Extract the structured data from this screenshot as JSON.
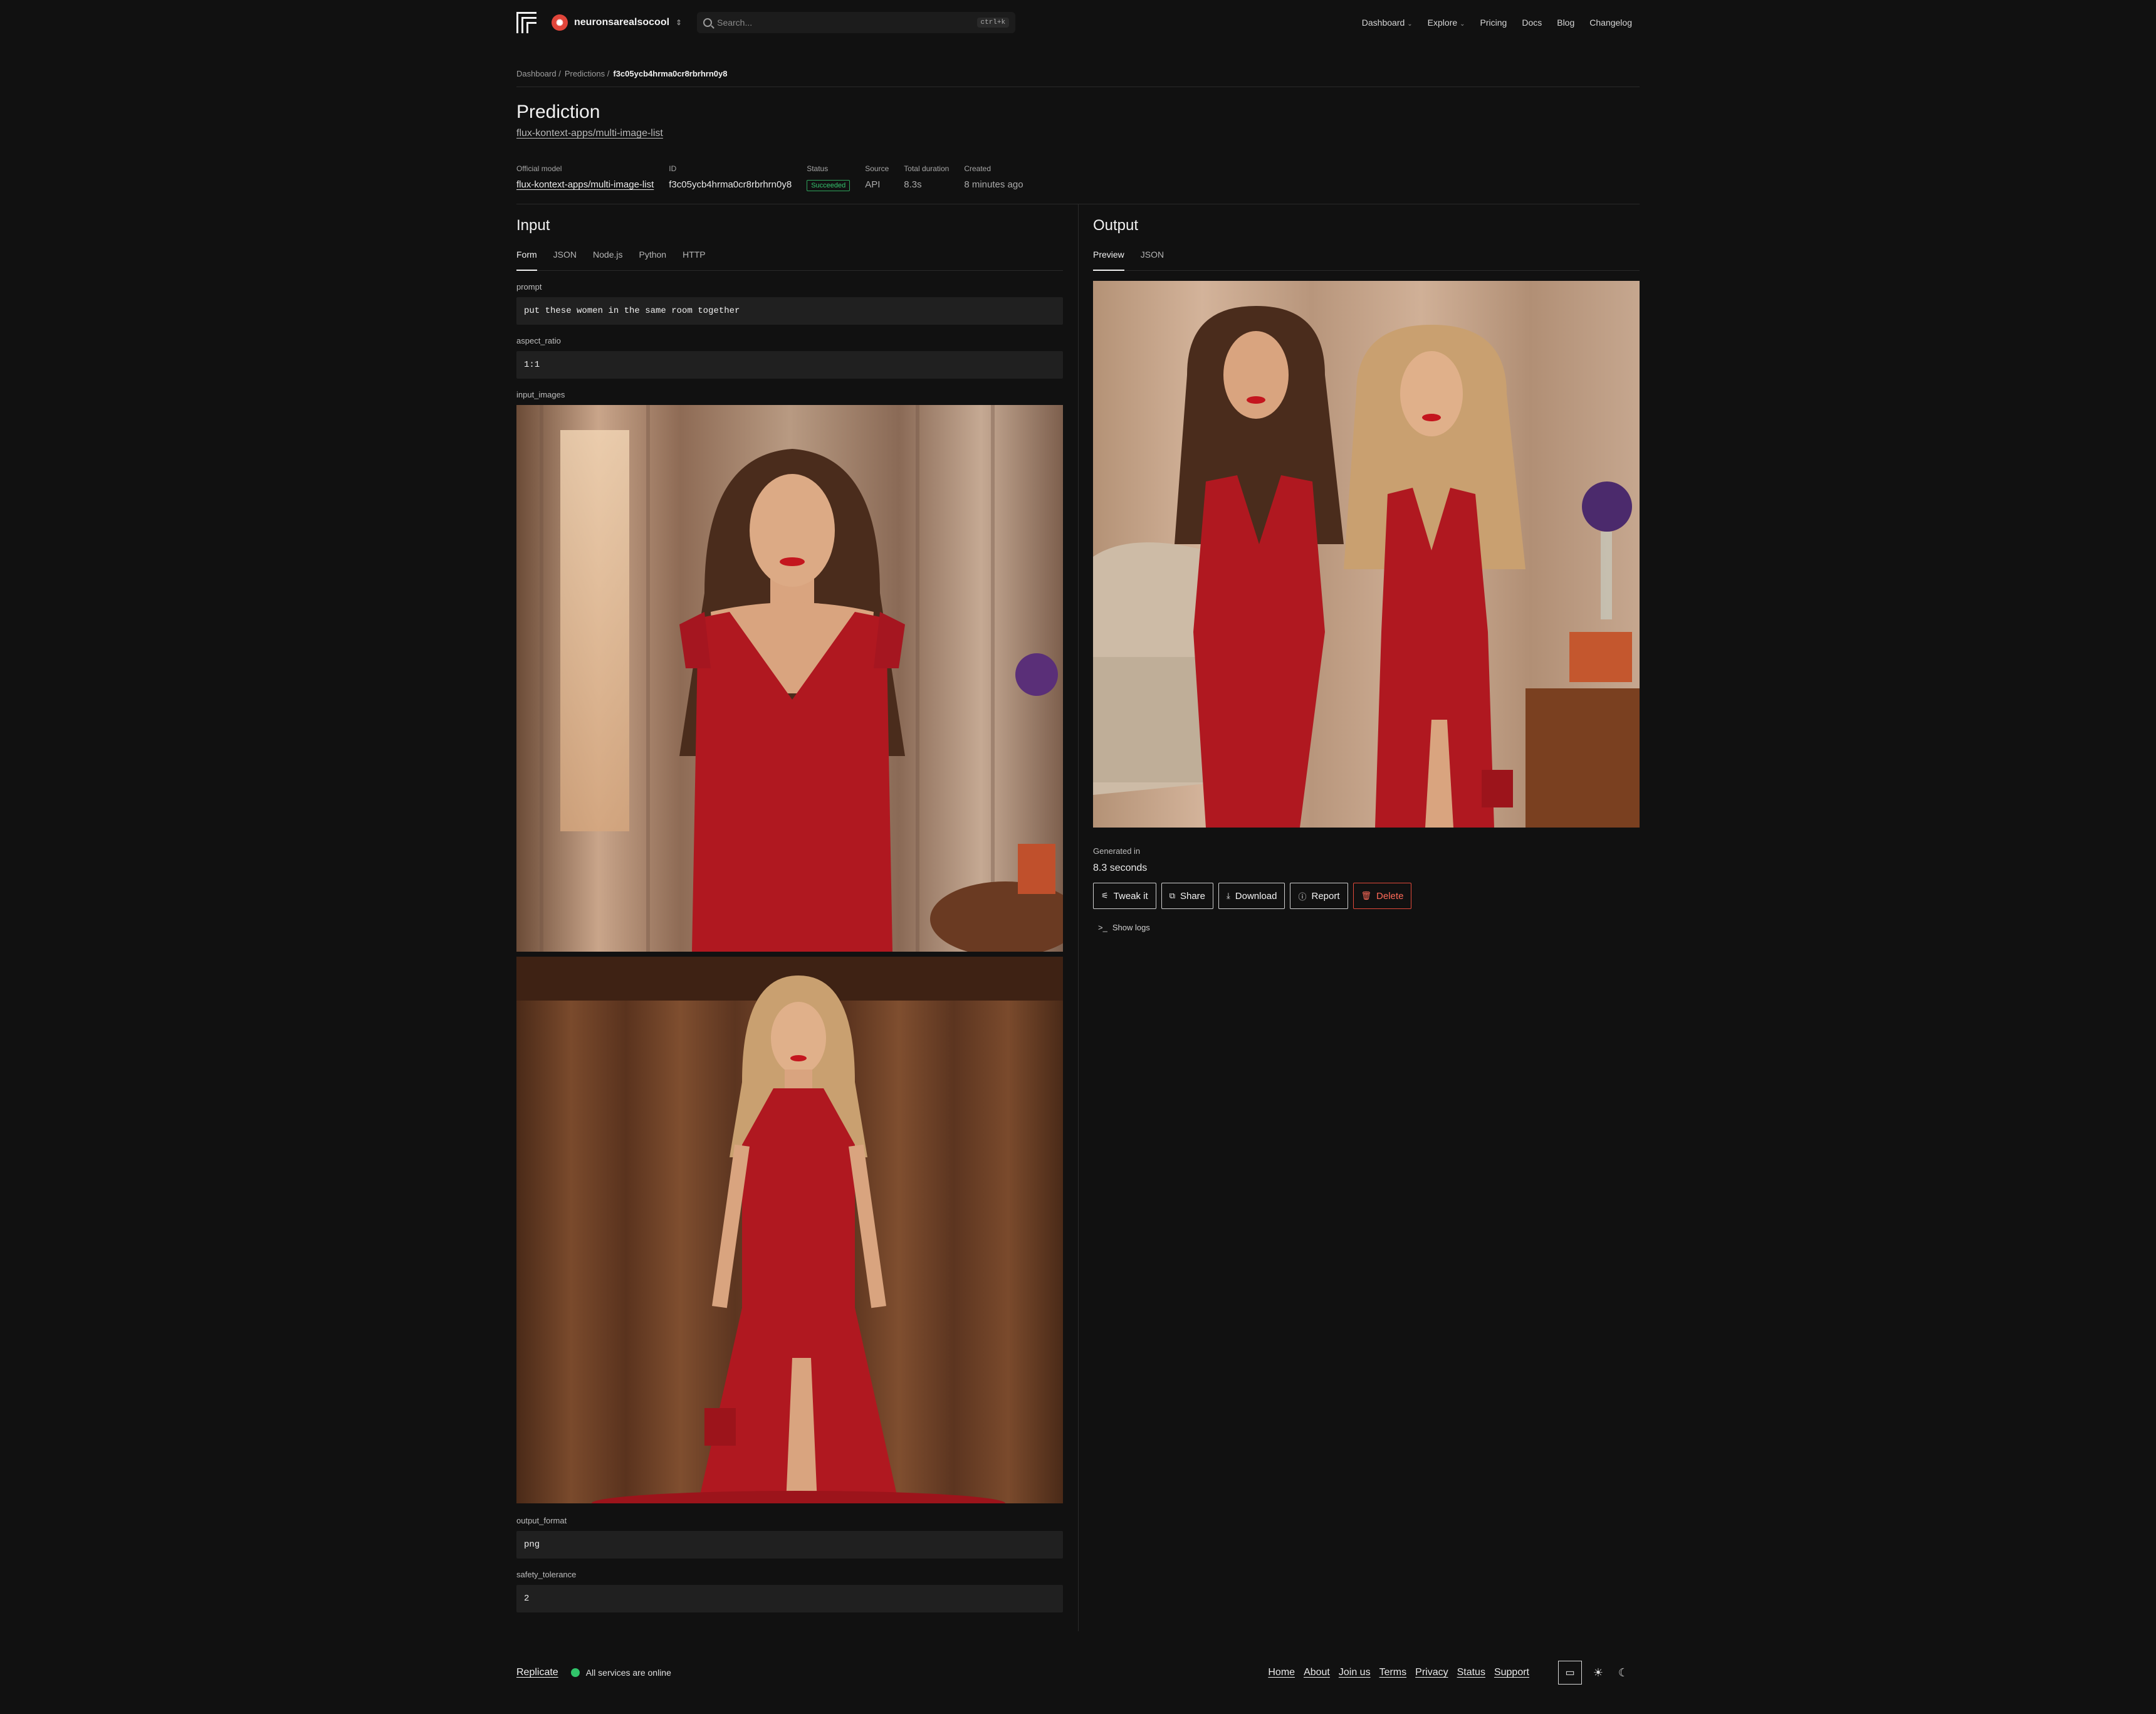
{
  "header": {
    "org_name": "neuronsarealsocool",
    "search_placeholder": "Search...",
    "search_shortcut": "ctrl+k",
    "nav": [
      "Dashboard",
      "Explore",
      "Pricing",
      "Docs",
      "Blog",
      "Changelog"
    ]
  },
  "breadcrumb": {
    "items": [
      "Dashboard /",
      "Predictions /"
    ],
    "current": "f3c05ycb4hrma0cr8rbrhrn0y8"
  },
  "page": {
    "title": "Prediction",
    "model_link": "flux-kontext-apps/multi-image-list"
  },
  "meta": {
    "official_model_label": "Official model",
    "official_model": "flux-kontext-apps/multi-image-list",
    "id_label": "ID",
    "id": "f3c05ycb4hrma0cr8rbrhrn0y8",
    "status_label": "Status",
    "status": "Succeeded",
    "source_label": "Source",
    "source": "API",
    "duration_label": "Total duration",
    "duration": "8.3s",
    "created_label": "Created",
    "created": "8 minutes ago"
  },
  "input": {
    "title": "Input",
    "tabs": [
      "Form",
      "JSON",
      "Node.js",
      "Python",
      "HTTP"
    ],
    "prompt_label": "prompt",
    "prompt": "put these women in the same room together",
    "aspect_label": "aspect_ratio",
    "aspect": "1:1",
    "images_label": "input_images",
    "format_label": "output_format",
    "format": "png",
    "safety_label": "safety_tolerance",
    "safety": "2"
  },
  "output": {
    "title": "Output",
    "tabs": [
      "Preview",
      "JSON"
    ],
    "generated_label": "Generated in",
    "generated": "8.3 seconds",
    "buttons": [
      "Tweak it",
      "Share",
      "Download",
      "Report",
      "Delete"
    ],
    "show_logs": "Show logs"
  },
  "footer": {
    "brand": "Replicate",
    "status": "All services are online",
    "links": [
      "Home",
      "About",
      "Join us",
      "Terms",
      "Privacy",
      "Status",
      "Support"
    ]
  },
  "colors": {
    "background": "#111111",
    "status_green": "#31c46a",
    "danger": "#e24a3b",
    "dress_red": "#b01820"
  }
}
